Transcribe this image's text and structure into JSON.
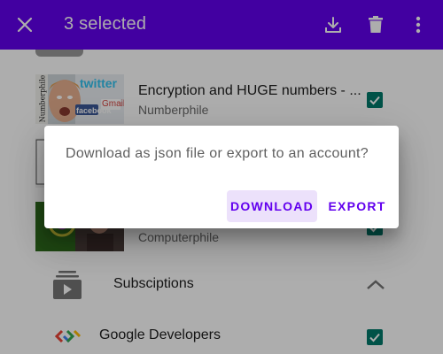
{
  "appbar": {
    "title": "3 selected",
    "close_icon": "close-icon",
    "download_icon": "download-icon",
    "delete_icon": "delete-icon",
    "more_icon": "more-vert-icon",
    "color": "#6200ee"
  },
  "videos": [
    {
      "title": "Encryption and HUGE numbers - ...",
      "channel": "Numberphile",
      "thumb_text": "Numberphile",
      "thumb_logo1": "twitter",
      "thumb_logo2": "facebook",
      "thumb_logo3": "Gmail",
      "checked": true
    },
    {
      "title": "",
      "channel": "",
      "checked": true
    },
    {
      "title": "",
      "channel": "Computerphile",
      "checked": true
    }
  ],
  "subscriptions": {
    "label": "Subsciptions",
    "icon": "subscriptions-icon",
    "expand_icon": "chevron-up-icon"
  },
  "channels": [
    {
      "label": "Google Developers",
      "icon": "google-developers-icon",
      "checked": true
    }
  ],
  "dialog": {
    "message": "Download as json file or export to an account?",
    "download_label": "DOWNLOAD",
    "export_label": "EXPORT"
  },
  "colors": {
    "accent": "#6200ee",
    "checkbox": "#00796b"
  }
}
